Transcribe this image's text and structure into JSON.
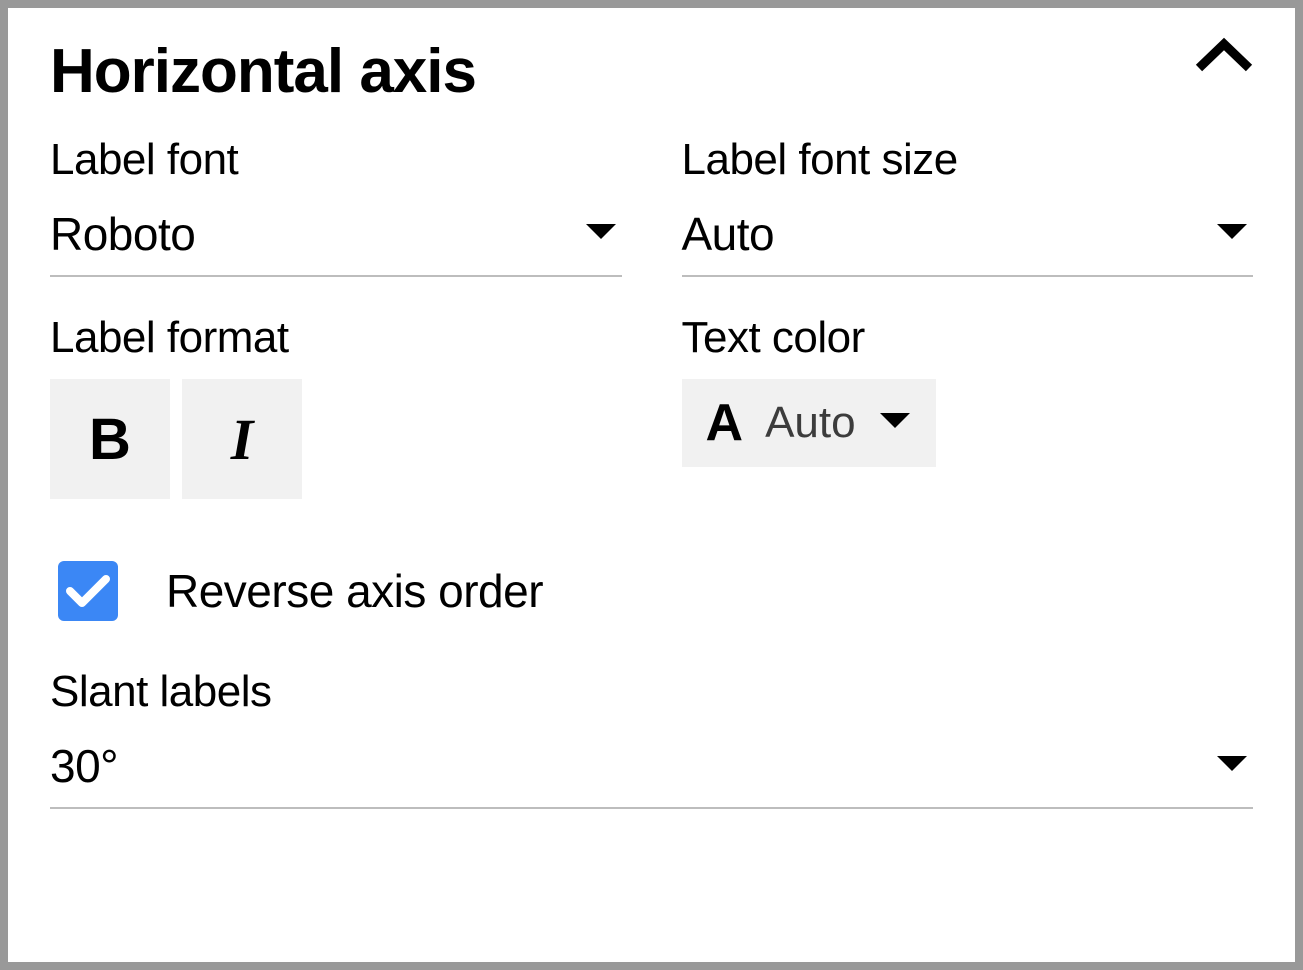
{
  "section": {
    "title": "Horizontal axis"
  },
  "labelFont": {
    "label": "Label font",
    "value": "Roboto"
  },
  "labelFontSize": {
    "label": "Label font size",
    "value": "Auto"
  },
  "labelFormat": {
    "label": "Label format",
    "bold_glyph": "B",
    "italic_glyph": "I"
  },
  "textColor": {
    "label": "Text color",
    "glyph": "A",
    "value": "Auto"
  },
  "reverseAxis": {
    "label": "Reverse axis order",
    "checked": true
  },
  "slantLabels": {
    "label": "Slant labels",
    "value": "30°"
  },
  "colors": {
    "checkbox_bg": "#3b87f5",
    "button_bg": "#f1f1f1",
    "border": "#bdbdbd"
  }
}
